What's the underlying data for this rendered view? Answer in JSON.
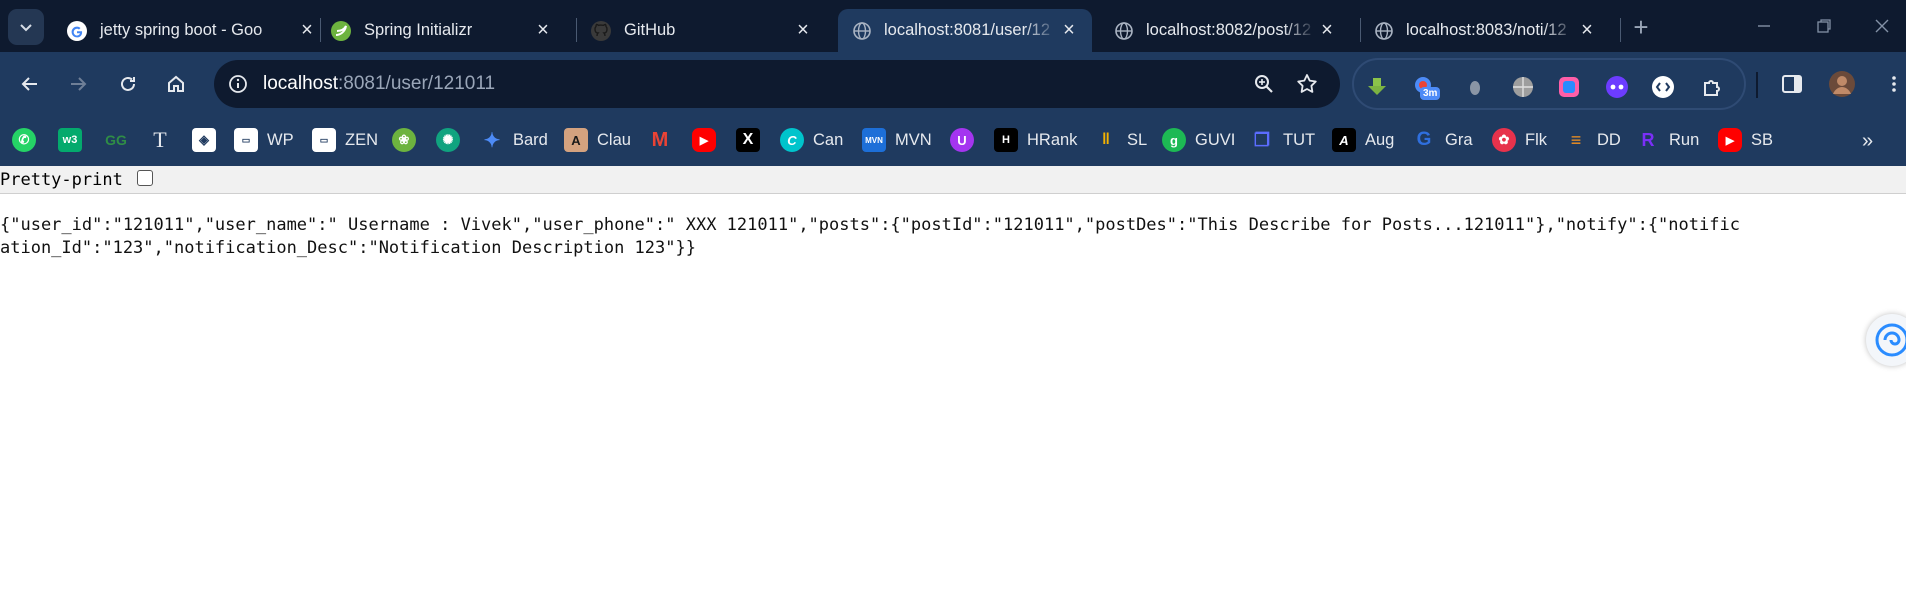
{
  "tabs": [
    {
      "title": "jetty spring boot - Goo",
      "favicon": "google-icon",
      "active": false
    },
    {
      "title": "Spring Initializr",
      "favicon": "spring-icon",
      "active": false
    },
    {
      "title": "GitHub",
      "favicon": "github-icon",
      "active": false
    },
    {
      "title": "localhost:8081/user/12",
      "favicon": "globe-icon",
      "active": true
    },
    {
      "title": "localhost:8082/post/12",
      "favicon": "globe-icon",
      "active": false
    },
    {
      "title": "localhost:8083/noti/12",
      "favicon": "globe-icon",
      "active": false
    }
  ],
  "address_bar": {
    "host": "localhost",
    "rest": ":8081/user/121011"
  },
  "extensions": {
    "badge": "3m"
  },
  "bookmarks": [
    {
      "label": "",
      "icon": "whatsapp-icon",
      "color": "#25d366"
    },
    {
      "label": "",
      "icon": "w3schools-icon",
      "color": "#04aa6d"
    },
    {
      "label": "",
      "icon": "geeksforgeeks-icon",
      "color": "#2f8d46"
    },
    {
      "label": "",
      "icon": "typewriter-icon",
      "color": "#1f3a5f"
    },
    {
      "label": "",
      "icon": "diamond-icon",
      "color": "#ffffff"
    },
    {
      "label": "WP",
      "icon": "wp-icon",
      "color": "#ffffff"
    },
    {
      "label": "ZEN",
      "icon": "zen-icon",
      "color": "#ffffff"
    },
    {
      "label": "",
      "icon": "spring-icon",
      "color": "#6db33f"
    },
    {
      "label": "",
      "icon": "chatgpt-icon",
      "color": "#10a37f"
    },
    {
      "label": "Bard",
      "icon": "bard-icon",
      "color": "#4285f4"
    },
    {
      "label": "Clau",
      "icon": "claude-icon",
      "color": "#d4a27f"
    },
    {
      "label": "",
      "icon": "gmail-icon",
      "color": "#ea4335"
    },
    {
      "label": "",
      "icon": "youtube-icon",
      "color": "#ff0000"
    },
    {
      "label": "",
      "icon": "x-icon",
      "color": "#000000"
    },
    {
      "label": "Can",
      "icon": "canva-icon",
      "color": "#00c4cc"
    },
    {
      "label": "MVN",
      "icon": "mvn-icon",
      "color": "#1d6fd8"
    },
    {
      "label": "",
      "icon": "udemy-icon",
      "color": "#a435f0"
    },
    {
      "label": "HRank",
      "icon": "hackerrank-icon",
      "color": "#000000"
    },
    {
      "label": "SL",
      "icon": "sl-icon",
      "color": "#f5b300"
    },
    {
      "label": "GUVI",
      "icon": "guvi-icon",
      "color": "#1db954"
    },
    {
      "label": "TUT",
      "icon": "book-icon",
      "color": "#5b6cff"
    },
    {
      "label": "Aug",
      "icon": "aug-icon",
      "color": "#000000"
    },
    {
      "label": "Gra",
      "icon": "grammarly-icon",
      "color": "#2f6fde"
    },
    {
      "label": "Flk",
      "icon": "flaticon-icon",
      "color": "#e7324c"
    },
    {
      "label": "DD",
      "icon": "dd-icon",
      "color": "#f7931e"
    },
    {
      "label": "Run",
      "icon": "run-icon",
      "color": "#7b2ff7"
    },
    {
      "label": "SB",
      "icon": "youtube-icon",
      "color": "#ff0000"
    }
  ],
  "content": {
    "pretty_print_label": "Pretty-print",
    "json_text": "{\"user_id\":\"121011\",\"user_name\":\" Username : Vivek\",\"user_phone\":\" XXX 121011\",\"posts\":{\"postId\":\"121011\",\"postDes\":\"This Describe for Posts...121011\"},\"notify\":{\"notification_Id\":\"123\",\"notification_Desc\":\"Notification Description 123\"}}"
  },
  "colors": {
    "tabstrip_bg": "#0e1a2f",
    "toolbar_bg": "#1f3a5f",
    "accent": "#4d8bf7"
  }
}
